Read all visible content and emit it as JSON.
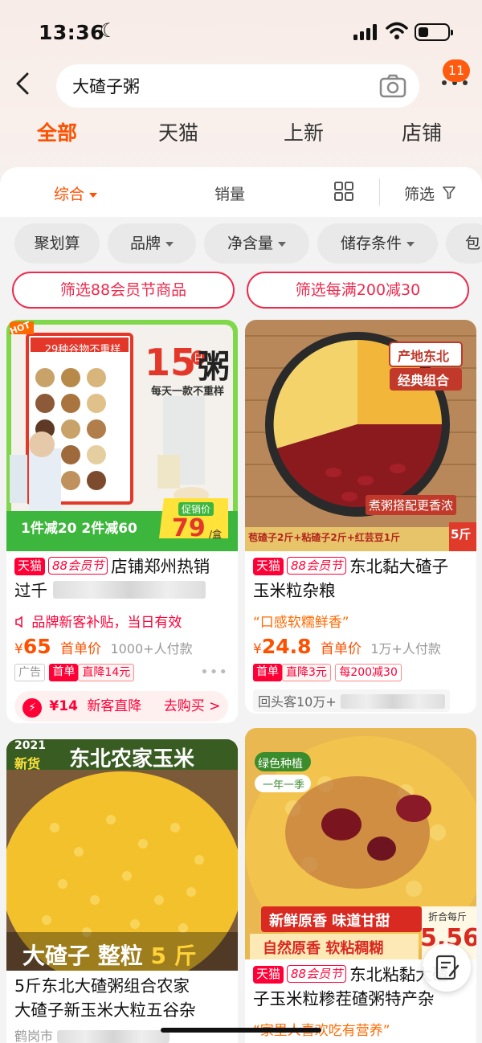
{
  "status_bar": {
    "time": "13:36"
  },
  "search": {
    "query": "大碴子粥",
    "notification_count": "11"
  },
  "tabs": [
    {
      "label": "全部",
      "active": true
    },
    {
      "label": "天猫",
      "active": false
    },
    {
      "label": "上新",
      "active": false
    },
    {
      "label": "店铺",
      "active": false
    }
  ],
  "sortbar": {
    "comprehensive": "综合",
    "sales": "销量",
    "filter": "筛选"
  },
  "chips": [
    "聚划算",
    "品牌",
    "净含量",
    "储存条件",
    "包"
  ],
  "filter_buttons": [
    "筛选88会员节商品",
    "筛选每满200减30"
  ],
  "products": [
    {
      "image_text": {
        "banner": "29种谷物不重样",
        "big": "15",
        "big_unit": "日",
        "big2": "粥",
        "sub": "每天一款不重样",
        "corner": "HOT",
        "promo": "1件减20 2件减60",
        "price_label": "促销价",
        "price": "79",
        "price_unit": "/盒"
      },
      "tag_tmall": "天猫",
      "tag_88": "88会员节",
      "title_1": "店铺郑州热销",
      "title_2": "过千",
      "notice": "品牌新客补贴，当日有效",
      "price_symbol": "¥",
      "price": "65",
      "price_note": "首单价",
      "sales": "1000+人付款",
      "tags": [
        "广告",
        "首单",
        "直降14元"
      ],
      "coupon": {
        "amount": "¥14",
        "label": "新客直降",
        "action": "去购买 >"
      }
    },
    {
      "image_text": {
        "badge1": "产地东北",
        "badge2": "经典组合",
        "caption": "煮粥搭配更香浓",
        "bottom": "苞碴子2斤+粘碴子2斤+红芸豆1斤",
        "weight": "5斤"
      },
      "tag_tmall": "天猫",
      "tag_88": "88会员节",
      "title_1": "东北黏大碴子",
      "title_2": "玉米粒杂粮",
      "quote": "“口感软糯鲜香”",
      "price_symbol": "¥",
      "price": "24.8",
      "price_note": "首单价",
      "sales": "1万+人付款",
      "tags": [
        "首单",
        "直降3元",
        "每200减30"
      ],
      "repeat": "回头客10万+"
    },
    {
      "image_text": {
        "year": "2021",
        "new": "新货",
        "banner": "东北农家玉米",
        "bottom_a": "大碴子 整粒",
        "bottom_b": "5 斤"
      },
      "title_1": "5斤东北大碴粥组合农家",
      "title_2": "大碴子新玉米大粒五谷杂",
      "location": "鹤岗市"
    },
    {
      "image_text": {
        "badge1": "绿色种植",
        "badge2": "一年一季",
        "cap1": "新鲜原香 味道甘甜",
        "cap2": "自然原香 软粘稠糊",
        "price_label": "折合每斤",
        "price": "5.56"
      },
      "tag_tmall": "天猫",
      "tag_88": "88会员节",
      "title_1": "东北粘黏大碴",
      "title_2": "子玉米粒糁茬碴粥特产杂",
      "quote": "“家里人喜欢吃有营养”"
    }
  ],
  "colors": {
    "accent": "#ff5000",
    "tmall_red": "#ff0036",
    "border_pink": "#ec2b4e"
  }
}
